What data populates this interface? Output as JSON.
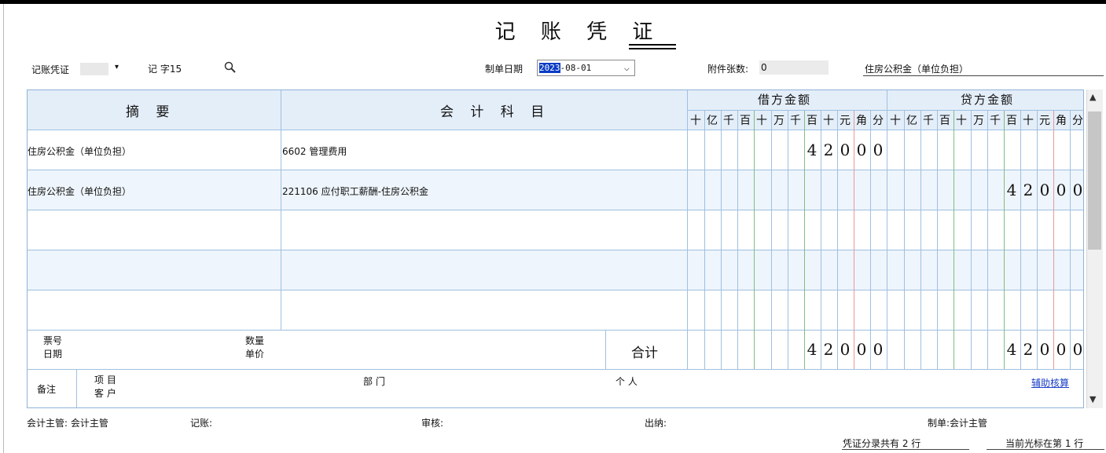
{
  "title": "记 账 凭 证",
  "voucher_type": "记账凭证",
  "voucher_word": "记 字15",
  "date_label": "制单日期",
  "date_value_selected": "2023",
  "date_value_rest": "-08-01",
  "attachments_label": "附件张数:",
  "attachments_value": "0",
  "voucher_header_text": "住房公积金（单位负担）",
  "columns": {
    "summary": "摘 要",
    "account": "会 计 科 目",
    "debit": "借方金额",
    "credit": "贷方金额",
    "digits": [
      "十",
      "亿",
      "千",
      "百",
      "十",
      "万",
      "千",
      "百",
      "十",
      "元",
      "角",
      "分"
    ]
  },
  "entries": [
    {
      "summary": "住房公积金（单位负担）",
      "account": "6602 管理费用",
      "debit": "42000",
      "credit": ""
    },
    {
      "summary": "住房公积金（单位负担）",
      "account": "221106 应付职工薪酬-住房公积金",
      "debit": "",
      "credit": "42000"
    },
    {
      "summary": "",
      "account": "",
      "debit": "",
      "credit": ""
    },
    {
      "summary": "",
      "account": "",
      "debit": "",
      "credit": ""
    },
    {
      "summary": "",
      "account": "",
      "debit": "",
      "credit": ""
    }
  ],
  "bottom": {
    "ticket_no": "票号",
    "date": "日期",
    "quantity": "数量",
    "unit_price": "单价",
    "total_label": "合计",
    "total_debit": "42000",
    "total_credit": "42000",
    "remark": "备注",
    "project": "项 目",
    "customer": "客 户",
    "department": "部 门",
    "person": "个 人",
    "aux_link": "辅助核算"
  },
  "footer": {
    "chief": "会计主管: 会计主管",
    "bookkeeper": "记账:",
    "reviewer": "审核:",
    "cashier": "出纳:",
    "maker": "制单:会计主管",
    "lines_status": "凭证分录共有 2 行",
    "cursor_status": "当前光标在第 1 行"
  }
}
